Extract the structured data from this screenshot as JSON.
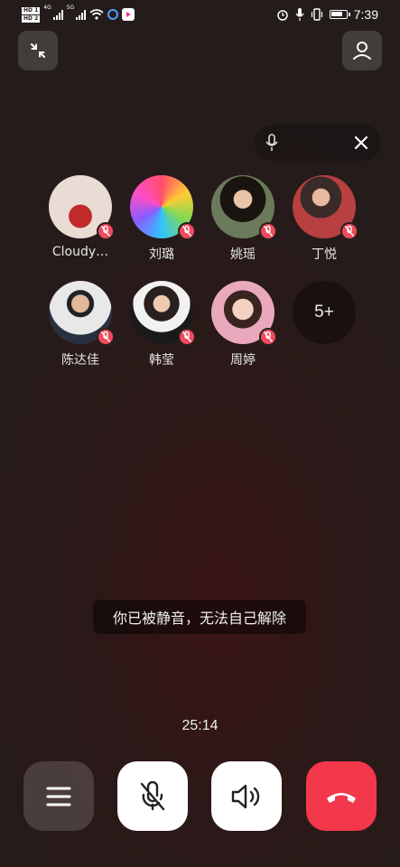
{
  "status_bar": {
    "sim1": "HD 1",
    "sim2": "HD 2",
    "net1": "4G",
    "net2": "5G",
    "time": "7:39"
  },
  "search_pill": {
    "mic_icon": "mic-icon",
    "close_icon": "close-icon"
  },
  "participants": [
    {
      "name": "Cloudy…",
      "muted": true,
      "avatar_color": "#d9cfc8"
    },
    {
      "name": "刘璐",
      "muted": true,
      "avatar_color": "#6a8a3a"
    },
    {
      "name": "姚瑶",
      "muted": true,
      "avatar_color": "#5a4a3a"
    },
    {
      "name": "丁悦",
      "muted": true,
      "avatar_color": "#a05050"
    },
    {
      "name": "陈达佳",
      "muted": true,
      "avatar_color": "#e8e8e8"
    },
    {
      "name": "韩莹",
      "muted": true,
      "avatar_color": "#ececec"
    },
    {
      "name": "周婷",
      "muted": true,
      "avatar_color": "#e8a8b8"
    }
  ],
  "more_participants": "5+",
  "toast": "你已被静音，无法自己解除",
  "call_timer": "25:14",
  "controls": {
    "menu_icon": "menu-icon",
    "mic_icon": "mic-off-icon",
    "speaker_icon": "speaker-icon",
    "hangup_icon": "hangup-icon"
  },
  "colors": {
    "hangup": "#f2374b",
    "mute_badge": "#f04a5d"
  }
}
